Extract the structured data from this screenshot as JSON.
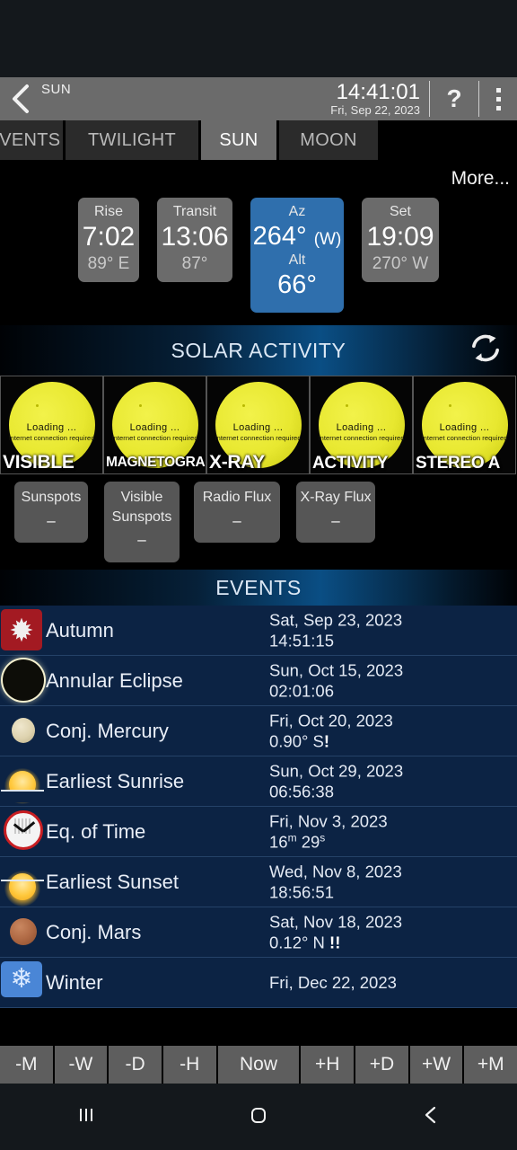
{
  "action_bar": {
    "back_icon": "chevron-left-icon",
    "title": "SUN",
    "time": "14:41:01",
    "date": "Fri, Sep 22, 2023",
    "help_label": "?",
    "overflow_icon": "more-vertical-icon"
  },
  "tabs": [
    {
      "label": "EVENTS",
      "active": false
    },
    {
      "label": "TWILIGHT",
      "active": false
    },
    {
      "label": "SUN",
      "active": true
    },
    {
      "label": "MOON",
      "active": false
    }
  ],
  "more_link": "More...",
  "sun_cards": [
    {
      "label": "Rise",
      "value": "7:02",
      "sub": "89° E",
      "highlight": false
    },
    {
      "label": "Transit",
      "value": "13:06",
      "sub": "87°",
      "highlight": false
    },
    {
      "label": "Az",
      "value": "264°",
      "value_suffix": "(W)",
      "label2": "Alt",
      "value2": "66°",
      "highlight": true
    },
    {
      "label": "Set",
      "value": "19:09",
      "sub": "270° W",
      "highlight": false
    }
  ],
  "solar_activity": {
    "header": "SOLAR ACTIVITY",
    "refresh_icon": "refresh-icon",
    "tiles": [
      {
        "caption": "VISIBLE",
        "loading": "Loading ...",
        "note": "Internet connection required"
      },
      {
        "caption": "MAGNETOGRAM",
        "loading": "Loading ...",
        "note": "Internet connection required"
      },
      {
        "caption": "X-RAY",
        "loading": "Loading ...",
        "note": "Internet connection required"
      },
      {
        "caption": "ACTIVITY",
        "loading": "Loading ...",
        "note": "Internet connection required"
      },
      {
        "caption": "STEREO A",
        "loading": "Loading ...",
        "note": "Internet connection required"
      }
    ],
    "flux": [
      {
        "label": "Sunspots",
        "value": "–"
      },
      {
        "label": "Visible Sunspots",
        "value": "–"
      },
      {
        "label": "Radio Flux",
        "value": "–"
      },
      {
        "label": "X-Ray Flux",
        "value": "–"
      }
    ]
  },
  "events": {
    "header": "EVENTS",
    "rows": [
      {
        "icon": "maple-leaf-icon",
        "name": "Autumn",
        "date": "Sat, Sep 23, 2023",
        "detail": "14:51:15"
      },
      {
        "icon": "annular-eclipse-icon",
        "name": "Annular Eclipse",
        "date": "Sun, Oct 15, 2023",
        "detail": "02:01:06"
      },
      {
        "icon": "mercury-icon",
        "name": "Conj. Mercury",
        "date": "Fri, Oct 20, 2023",
        "detail": "0.90° S",
        "flag": "!"
      },
      {
        "icon": "sunrise-icon",
        "name": "Earliest Sunrise",
        "date": "Sun, Oct 29, 2023",
        "detail": "06:56:38"
      },
      {
        "icon": "clock-icon",
        "name": "Eq. of Time",
        "date": "Fri, Nov 3, 2023",
        "detail_html": "16m 29s",
        "detail_num1": "16",
        "detail_sup1": "m",
        "detail_num2": "29",
        "detail_sup2": "s"
      },
      {
        "icon": "sunset-icon",
        "name": "Earliest Sunset",
        "date": "Wed, Nov 8, 2023",
        "detail": "18:56:51"
      },
      {
        "icon": "mars-icon",
        "name": "Conj. Mars",
        "date": "Sat, Nov 18, 2023",
        "detail": "0.12° N",
        "flag": "!!"
      },
      {
        "icon": "snowflake-icon",
        "name": "Winter",
        "date": "Fri, Dec 22, 2023",
        "detail": ""
      }
    ]
  },
  "timebar": [
    {
      "label": "-M"
    },
    {
      "label": "-W"
    },
    {
      "label": "-D"
    },
    {
      "label": "-H"
    },
    {
      "label": "Now"
    },
    {
      "label": "+H"
    },
    {
      "label": "+D"
    },
    {
      "label": "+W"
    },
    {
      "label": "+M"
    }
  ],
  "navbar": [
    {
      "icon": "recents-icon"
    },
    {
      "icon": "home-icon"
    },
    {
      "icon": "back-icon"
    }
  ],
  "colors": {
    "accent_blue": "#2f6fad",
    "events_bg": "#0c2344",
    "bar_gray": "#6b6b6b"
  }
}
